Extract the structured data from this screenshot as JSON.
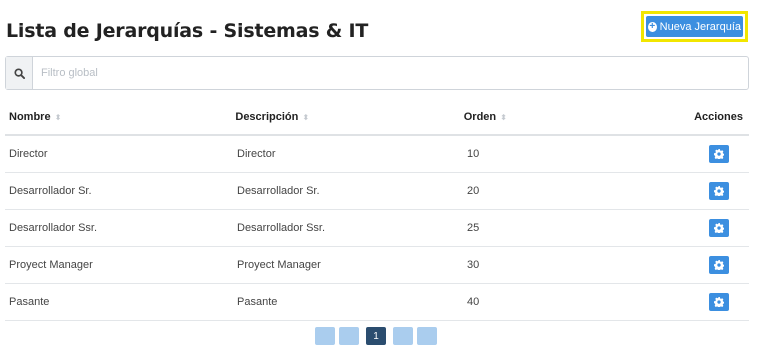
{
  "page": {
    "title": "Lista de Jerarquías - Sistemas & IT",
    "new_button_label": "Nueva Jerarquía"
  },
  "filter": {
    "placeholder": "Filtro global",
    "value": ""
  },
  "table": {
    "headers": {
      "nombre": "Nombre",
      "descripcion": "Descripción",
      "orden": "Orden",
      "acciones": "Acciones"
    },
    "rows": [
      {
        "nombre": "Director",
        "descripcion": "Director",
        "orden": "10"
      },
      {
        "nombre": "Desarrollador Sr.",
        "descripcion": "Desarrollador Sr.",
        "orden": "20"
      },
      {
        "nombre": "Desarrollador Ssr.",
        "descripcion": "Desarrollador Ssr.",
        "orden": "25"
      },
      {
        "nombre": "Proyect Manager",
        "descripcion": "Proyect Manager",
        "orden": "30"
      },
      {
        "nombre": "Pasante",
        "descripcion": "Pasante",
        "orden": "40"
      }
    ]
  },
  "pagination": {
    "current_page": "1"
  },
  "icons": {
    "filter": "search-icon",
    "new_button": "plus-circle-icon",
    "row_action": "gear-icon",
    "sort": "sort-icon"
  },
  "colors": {
    "primary": "#3c8fe0",
    "highlight": "#f2e600",
    "page_active": "#2b4d6f",
    "page_inactive": "#aacdee"
  }
}
